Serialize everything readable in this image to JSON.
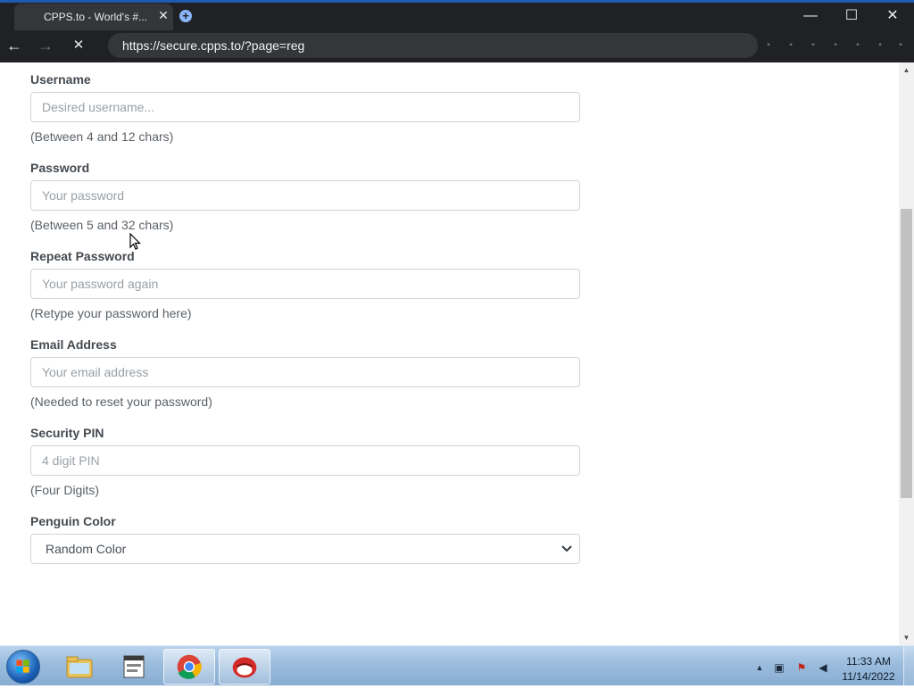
{
  "browser": {
    "tab_title": "CPPS.to - World's #...",
    "tab_close_glyph": "✕",
    "new_tab_glyph": "+",
    "url": "https://secure.cpps.to/?page=reg",
    "window_minimize_glyph": "—",
    "window_maximize_glyph": "☐",
    "window_close_glyph": "✕",
    "back_glyph": "←",
    "forward_glyph": "→",
    "stop_glyph": "✕"
  },
  "form": {
    "username": {
      "label": "Username",
      "placeholder": "Desired username...",
      "help": "(Between 4 and 12 chars)"
    },
    "password": {
      "label": "Password",
      "placeholder": "Your password",
      "help": "(Between 5 and 32 chars)"
    },
    "repeat_password": {
      "label": "Repeat Password",
      "placeholder": "Your password again",
      "help": "(Retype your password here)"
    },
    "email": {
      "label": "Email Address",
      "placeholder": "Your email address",
      "help": "(Needed to reset your password)"
    },
    "pin": {
      "label": "Security PIN",
      "placeholder": "4 digit PIN",
      "help": "(Four Digits)"
    },
    "penguin_color": {
      "label": "Penguin Color",
      "selected": "Random Color"
    }
  },
  "taskbar": {
    "clock_time": "11:33 AM",
    "clock_date": "11/14/2022"
  },
  "colors": {
    "chrome_dark": "#202124",
    "omnibox": "#35363a",
    "label_text": "#444a50",
    "help_text": "#5b6167",
    "taskbar": "#9bbcdd"
  }
}
